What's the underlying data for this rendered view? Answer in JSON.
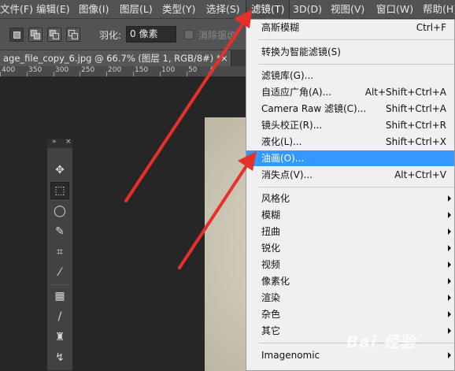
{
  "menubar": {
    "items": [
      "文件(F)",
      "编辑(E)",
      "图像(I)",
      "图层(L)",
      "类型(Y)",
      "选择(S)",
      "滤镜(T)",
      "3D(D)",
      "视图(V)",
      "窗口(W)",
      "帮助(H)"
    ]
  },
  "options": {
    "feather_label": "羽化:",
    "feather_value": "0 像素",
    "antialias_label": "消除锯齿"
  },
  "document": {
    "tab_title": "age_file_copy_6.jpg @ 66.7% (图层 1, RGB/8#) *",
    "close": "×"
  },
  "ruler": {
    "ticks": [
      "400",
      "350",
      "300",
      "250",
      "200",
      "150",
      "100",
      "50",
      "0",
      "50",
      "100",
      "150"
    ]
  },
  "filter_menu": {
    "items": [
      {
        "label": "高斯模糊",
        "shortcut": "Ctrl+F"
      },
      {
        "label": "转换为智能滤镜(S)",
        "shortcut": ""
      },
      {
        "label": "滤镜库(G)...",
        "shortcut": ""
      },
      {
        "label": "自适应广角(A)...",
        "shortcut": "Alt+Shift+Ctrl+A"
      },
      {
        "label": "Camera Raw 滤镜(C)...",
        "shortcut": "Shift+Ctrl+A"
      },
      {
        "label": "镜头校正(R)...",
        "shortcut": "Shift+Ctrl+R"
      },
      {
        "label": "液化(L)...",
        "shortcut": "Shift+Ctrl+X"
      },
      {
        "label": "油画(O)...",
        "shortcut": ""
      },
      {
        "label": "消失点(V)...",
        "shortcut": "Alt+Ctrl+V"
      },
      {
        "label": "风格化",
        "shortcut": ""
      },
      {
        "label": "模糊",
        "shortcut": ""
      },
      {
        "label": "扭曲",
        "shortcut": ""
      },
      {
        "label": "锐化",
        "shortcut": ""
      },
      {
        "label": "视频",
        "shortcut": ""
      },
      {
        "label": "像素化",
        "shortcut": ""
      },
      {
        "label": "渲染",
        "shortcut": ""
      },
      {
        "label": "杂色",
        "shortcut": ""
      },
      {
        "label": "其它",
        "shortcut": ""
      },
      {
        "label": "Imagenomic",
        "shortcut": ""
      }
    ],
    "highlighted_index": 7
  },
  "tool_icons": [
    "move-tool-icon",
    "marquee-tool-icon",
    "lasso-tool-icon",
    "quick-select-tool-icon",
    "crop-tool-icon",
    "eyedropper-tool-icon",
    "healing-brush-tool-icon",
    "brush-tool-icon",
    "clone-stamp-tool-icon",
    "history-brush-tool-icon"
  ],
  "tool_glyphs": [
    "✥",
    "⬚",
    "◯",
    "✎",
    "⌗",
    "⁄",
    "▦",
    "/",
    "♜",
    "↯"
  ],
  "watermark": "Bai 经验",
  "colors": {
    "menu_highlight": "#3399ff",
    "arrow_red": "#e8302a",
    "menubar_bg": "#535353"
  }
}
